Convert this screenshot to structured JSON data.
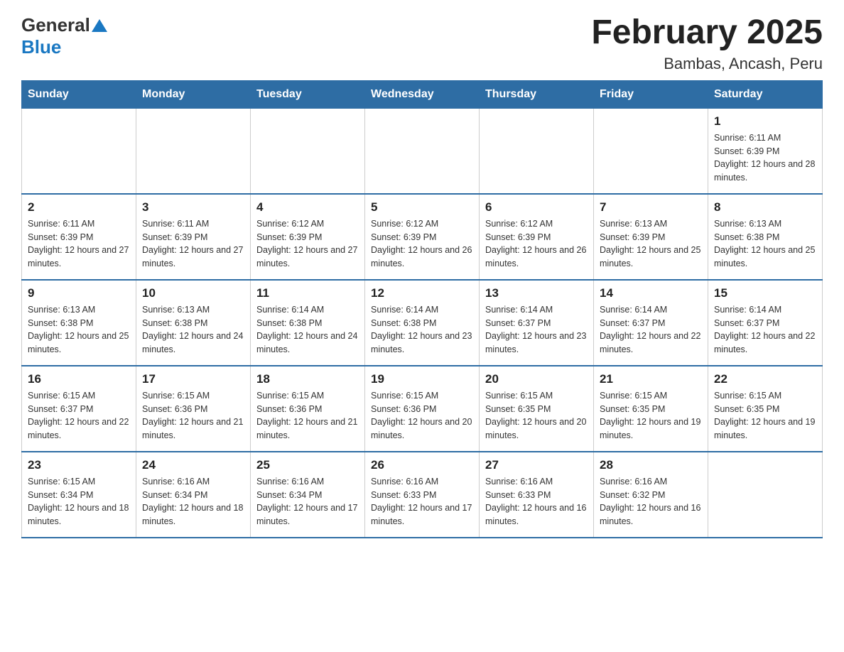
{
  "header": {
    "logo_general": "General",
    "logo_blue": "Blue",
    "month_title": "February 2025",
    "location": "Bambas, Ancash, Peru"
  },
  "days_of_week": [
    "Sunday",
    "Monday",
    "Tuesday",
    "Wednesday",
    "Thursday",
    "Friday",
    "Saturday"
  ],
  "weeks": [
    [
      {
        "day": "",
        "info": ""
      },
      {
        "day": "",
        "info": ""
      },
      {
        "day": "",
        "info": ""
      },
      {
        "day": "",
        "info": ""
      },
      {
        "day": "",
        "info": ""
      },
      {
        "day": "",
        "info": ""
      },
      {
        "day": "1",
        "info": "Sunrise: 6:11 AM\nSunset: 6:39 PM\nDaylight: 12 hours and 28 minutes."
      }
    ],
    [
      {
        "day": "2",
        "info": "Sunrise: 6:11 AM\nSunset: 6:39 PM\nDaylight: 12 hours and 27 minutes."
      },
      {
        "day": "3",
        "info": "Sunrise: 6:11 AM\nSunset: 6:39 PM\nDaylight: 12 hours and 27 minutes."
      },
      {
        "day": "4",
        "info": "Sunrise: 6:12 AM\nSunset: 6:39 PM\nDaylight: 12 hours and 27 minutes."
      },
      {
        "day": "5",
        "info": "Sunrise: 6:12 AM\nSunset: 6:39 PM\nDaylight: 12 hours and 26 minutes."
      },
      {
        "day": "6",
        "info": "Sunrise: 6:12 AM\nSunset: 6:39 PM\nDaylight: 12 hours and 26 minutes."
      },
      {
        "day": "7",
        "info": "Sunrise: 6:13 AM\nSunset: 6:39 PM\nDaylight: 12 hours and 25 minutes."
      },
      {
        "day": "8",
        "info": "Sunrise: 6:13 AM\nSunset: 6:38 PM\nDaylight: 12 hours and 25 minutes."
      }
    ],
    [
      {
        "day": "9",
        "info": "Sunrise: 6:13 AM\nSunset: 6:38 PM\nDaylight: 12 hours and 25 minutes."
      },
      {
        "day": "10",
        "info": "Sunrise: 6:13 AM\nSunset: 6:38 PM\nDaylight: 12 hours and 24 minutes."
      },
      {
        "day": "11",
        "info": "Sunrise: 6:14 AM\nSunset: 6:38 PM\nDaylight: 12 hours and 24 minutes."
      },
      {
        "day": "12",
        "info": "Sunrise: 6:14 AM\nSunset: 6:38 PM\nDaylight: 12 hours and 23 minutes."
      },
      {
        "day": "13",
        "info": "Sunrise: 6:14 AM\nSunset: 6:37 PM\nDaylight: 12 hours and 23 minutes."
      },
      {
        "day": "14",
        "info": "Sunrise: 6:14 AM\nSunset: 6:37 PM\nDaylight: 12 hours and 22 minutes."
      },
      {
        "day": "15",
        "info": "Sunrise: 6:14 AM\nSunset: 6:37 PM\nDaylight: 12 hours and 22 minutes."
      }
    ],
    [
      {
        "day": "16",
        "info": "Sunrise: 6:15 AM\nSunset: 6:37 PM\nDaylight: 12 hours and 22 minutes."
      },
      {
        "day": "17",
        "info": "Sunrise: 6:15 AM\nSunset: 6:36 PM\nDaylight: 12 hours and 21 minutes."
      },
      {
        "day": "18",
        "info": "Sunrise: 6:15 AM\nSunset: 6:36 PM\nDaylight: 12 hours and 21 minutes."
      },
      {
        "day": "19",
        "info": "Sunrise: 6:15 AM\nSunset: 6:36 PM\nDaylight: 12 hours and 20 minutes."
      },
      {
        "day": "20",
        "info": "Sunrise: 6:15 AM\nSunset: 6:35 PM\nDaylight: 12 hours and 20 minutes."
      },
      {
        "day": "21",
        "info": "Sunrise: 6:15 AM\nSunset: 6:35 PM\nDaylight: 12 hours and 19 minutes."
      },
      {
        "day": "22",
        "info": "Sunrise: 6:15 AM\nSunset: 6:35 PM\nDaylight: 12 hours and 19 minutes."
      }
    ],
    [
      {
        "day": "23",
        "info": "Sunrise: 6:15 AM\nSunset: 6:34 PM\nDaylight: 12 hours and 18 minutes."
      },
      {
        "day": "24",
        "info": "Sunrise: 6:16 AM\nSunset: 6:34 PM\nDaylight: 12 hours and 18 minutes."
      },
      {
        "day": "25",
        "info": "Sunrise: 6:16 AM\nSunset: 6:34 PM\nDaylight: 12 hours and 17 minutes."
      },
      {
        "day": "26",
        "info": "Sunrise: 6:16 AM\nSunset: 6:33 PM\nDaylight: 12 hours and 17 minutes."
      },
      {
        "day": "27",
        "info": "Sunrise: 6:16 AM\nSunset: 6:33 PM\nDaylight: 12 hours and 16 minutes."
      },
      {
        "day": "28",
        "info": "Sunrise: 6:16 AM\nSunset: 6:32 PM\nDaylight: 12 hours and 16 minutes."
      },
      {
        "day": "",
        "info": ""
      }
    ]
  ]
}
